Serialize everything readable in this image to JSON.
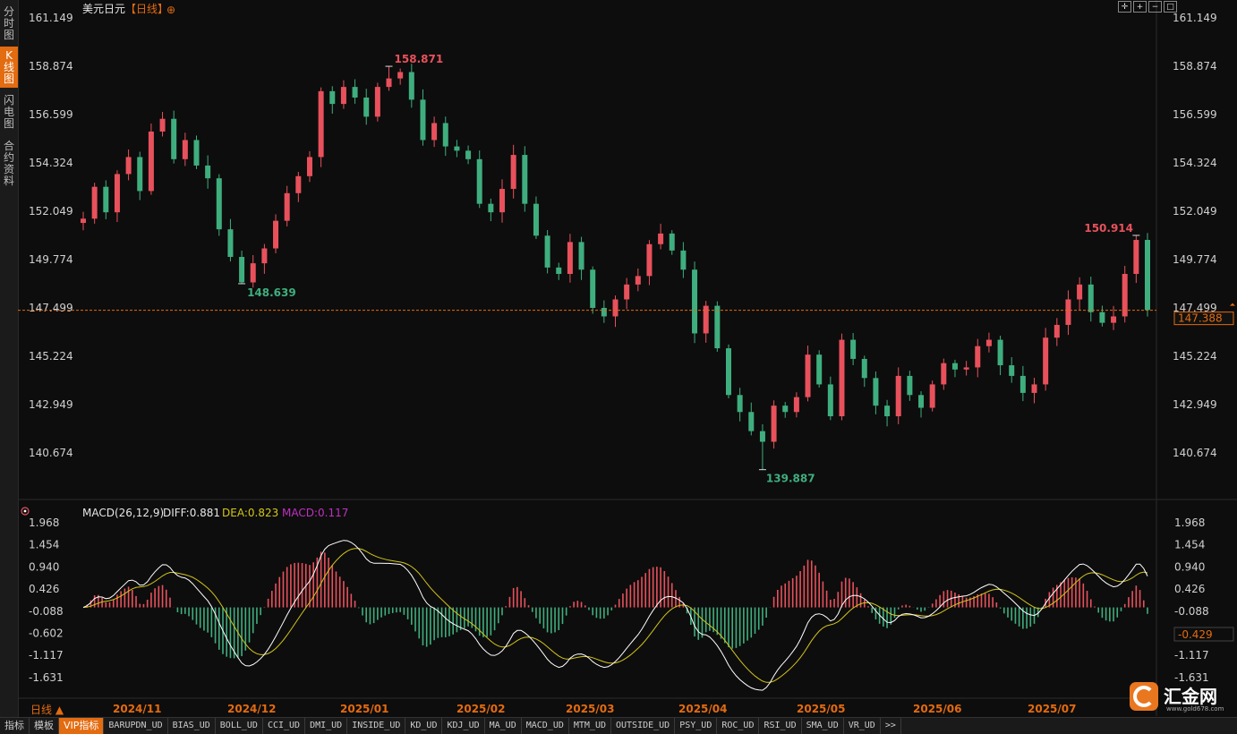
{
  "title": {
    "symbol": "美元日元",
    "period_tag": "【日线】",
    "add_icon": "⊕"
  },
  "side_tabs": [
    {
      "label": "分时图",
      "active": false
    },
    {
      "label": "K线图",
      "active": true
    },
    {
      "label": "闪电图",
      "active": false
    },
    {
      "label": "合约资料",
      "active": false
    }
  ],
  "toolbar_icons": [
    "crosshair-icon",
    "zoom-in-icon",
    "zoom-out-icon",
    "fullscreen-icon"
  ],
  "price_axis": {
    "ticks": [
      "161.149",
      "158.874",
      "156.599",
      "154.324",
      "152.049",
      "149.774",
      "147.499",
      "145.224",
      "142.949",
      "140.674"
    ],
    "current_price": "147.388",
    "current_price_value": 147.388
  },
  "annotations": {
    "high": "158.871",
    "low1": "148.639",
    "low2": "139.887",
    "recent_high": "150.914"
  },
  "macd": {
    "label": "MACD(26,12,9)",
    "diff_label": "DIFF:0.881",
    "dea_label": "DEA:0.823",
    "macd_label": "MACD:0.117",
    "current_value": "-0.429",
    "ticks": [
      "1.968",
      "1.454",
      "0.940",
      "0.426",
      "-0.088",
      "-0.602",
      "-1.117",
      "-1.631"
    ]
  },
  "time_axis": [
    "2024/11",
    "2024/12",
    "2025/01",
    "2025/02",
    "2025/03",
    "2025/04",
    "2025/05",
    "2025/06",
    "2025/07"
  ],
  "period_selector": "日线 ▲",
  "bottom_tabs": [
    "指标",
    "模板",
    "VIP指标",
    "BARUPDN_UD",
    "BIAS_UD",
    "BOLL_UD",
    "CCI_UD",
    "DMI_UD",
    "INSIDE_UD",
    "KD_UD",
    "KDJ_UD",
    "MA_UD",
    "MACD_UD",
    "MTM_UD",
    "OUTSIDE_UD",
    "PSY_UD",
    "ROC_UD",
    "RSI_UD",
    "SMA_UD",
    "VR_UD",
    ">>"
  ],
  "logo": {
    "name": "汇金网",
    "url": "www.gold678.com"
  },
  "colors": {
    "up": "#e8515c",
    "down": "#3fae7e",
    "accent": "#e36b10",
    "dea": "#d4c619",
    "diff": "#ffffff",
    "macd": "#c030c0"
  },
  "chart_data": {
    "type": "candlestick",
    "close_path": [
      151.7,
      153.2,
      152.0,
      153.8,
      154.6,
      153.0,
      155.8,
      156.4,
      154.5,
      155.4,
      154.2,
      153.6,
      151.2,
      149.9,
      148.7,
      149.6,
      150.3,
      151.6,
      152.9,
      153.7,
      154.6,
      157.7,
      157.1,
      157.9,
      157.4,
      156.5,
      157.9,
      158.3,
      158.6,
      157.3,
      155.4,
      156.2,
      155.1,
      154.9,
      154.5,
      152.4,
      152.0,
      153.1,
      154.7,
      152.4,
      150.9,
      149.4,
      149.1,
      150.6,
      149.3,
      147.5,
      147.1,
      147.9,
      148.6,
      149.0,
      150.5,
      151.0,
      150.2,
      149.3,
      146.3,
      147.6,
      145.6,
      143.4,
      142.6,
      141.7,
      141.2,
      142.9,
      142.6,
      143.3,
      145.3,
      143.9,
      142.4,
      146.0,
      145.1,
      144.2,
      142.9,
      142.4,
      144.3,
      143.4,
      142.8,
      143.9,
      144.9,
      144.6,
      144.7,
      145.7,
      146.0,
      144.8,
      144.3,
      143.5,
      143.9,
      146.1,
      146.7,
      147.9,
      148.6,
      147.3,
      146.8,
      147.1,
      149.1,
      150.7,
      147.4
    ],
    "ylim": [
      139.887,
      161.149
    ],
    "high": 158.871,
    "low": 139.887,
    "last": 147.388,
    "macd_ylim": [
      -2.0,
      2.1
    ]
  }
}
